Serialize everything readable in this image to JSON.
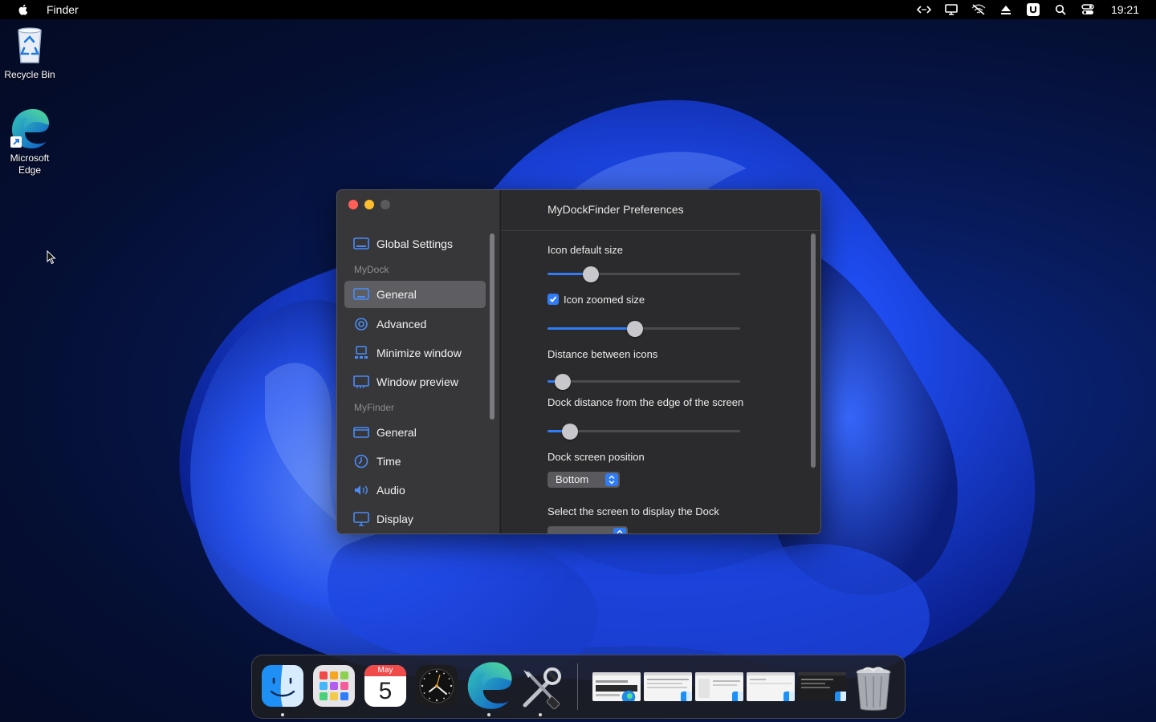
{
  "menubar": {
    "app_name": "Finder",
    "clock": "19:21"
  },
  "desktop": {
    "icons": [
      {
        "label": "Recycle Bin",
        "icon": "recycle-bin-icon"
      },
      {
        "label": "Microsoft Edge",
        "icon": "edge-icon"
      }
    ]
  },
  "window": {
    "title": "MyDockFinder Preferences",
    "sidebar": {
      "global": "Global Settings",
      "section_mydock": "MyDock",
      "mydock_items": [
        "General",
        "Advanced",
        "Minimize window",
        "Window preview"
      ],
      "section_myfinder": "MyFinder",
      "myfinder_items": [
        "General",
        "Time",
        "Audio",
        "Display"
      ],
      "active_item": "General"
    },
    "settings": {
      "icon_default_size": {
        "label": "Icon default size",
        "value": 0.2
      },
      "icon_zoomed_size": {
        "label": "Icon zoomed size",
        "checked": true,
        "value": 0.45
      },
      "distance_between_icons": {
        "label": "Distance between icons",
        "value": 0.04
      },
      "dock_distance_edge": {
        "label": "Dock distance from the edge of the screen",
        "value": 0.08
      },
      "dock_screen_position": {
        "label": "Dock screen position",
        "value": "Bottom"
      },
      "select_screen": {
        "label": "Select the screen to display the Dock"
      }
    }
  },
  "dock": {
    "calendar_month": "May",
    "calendar_day": "5"
  },
  "colors": {
    "accent": "#2f7cf6",
    "close": "#ff5f57",
    "minimize": "#febc2e"
  }
}
